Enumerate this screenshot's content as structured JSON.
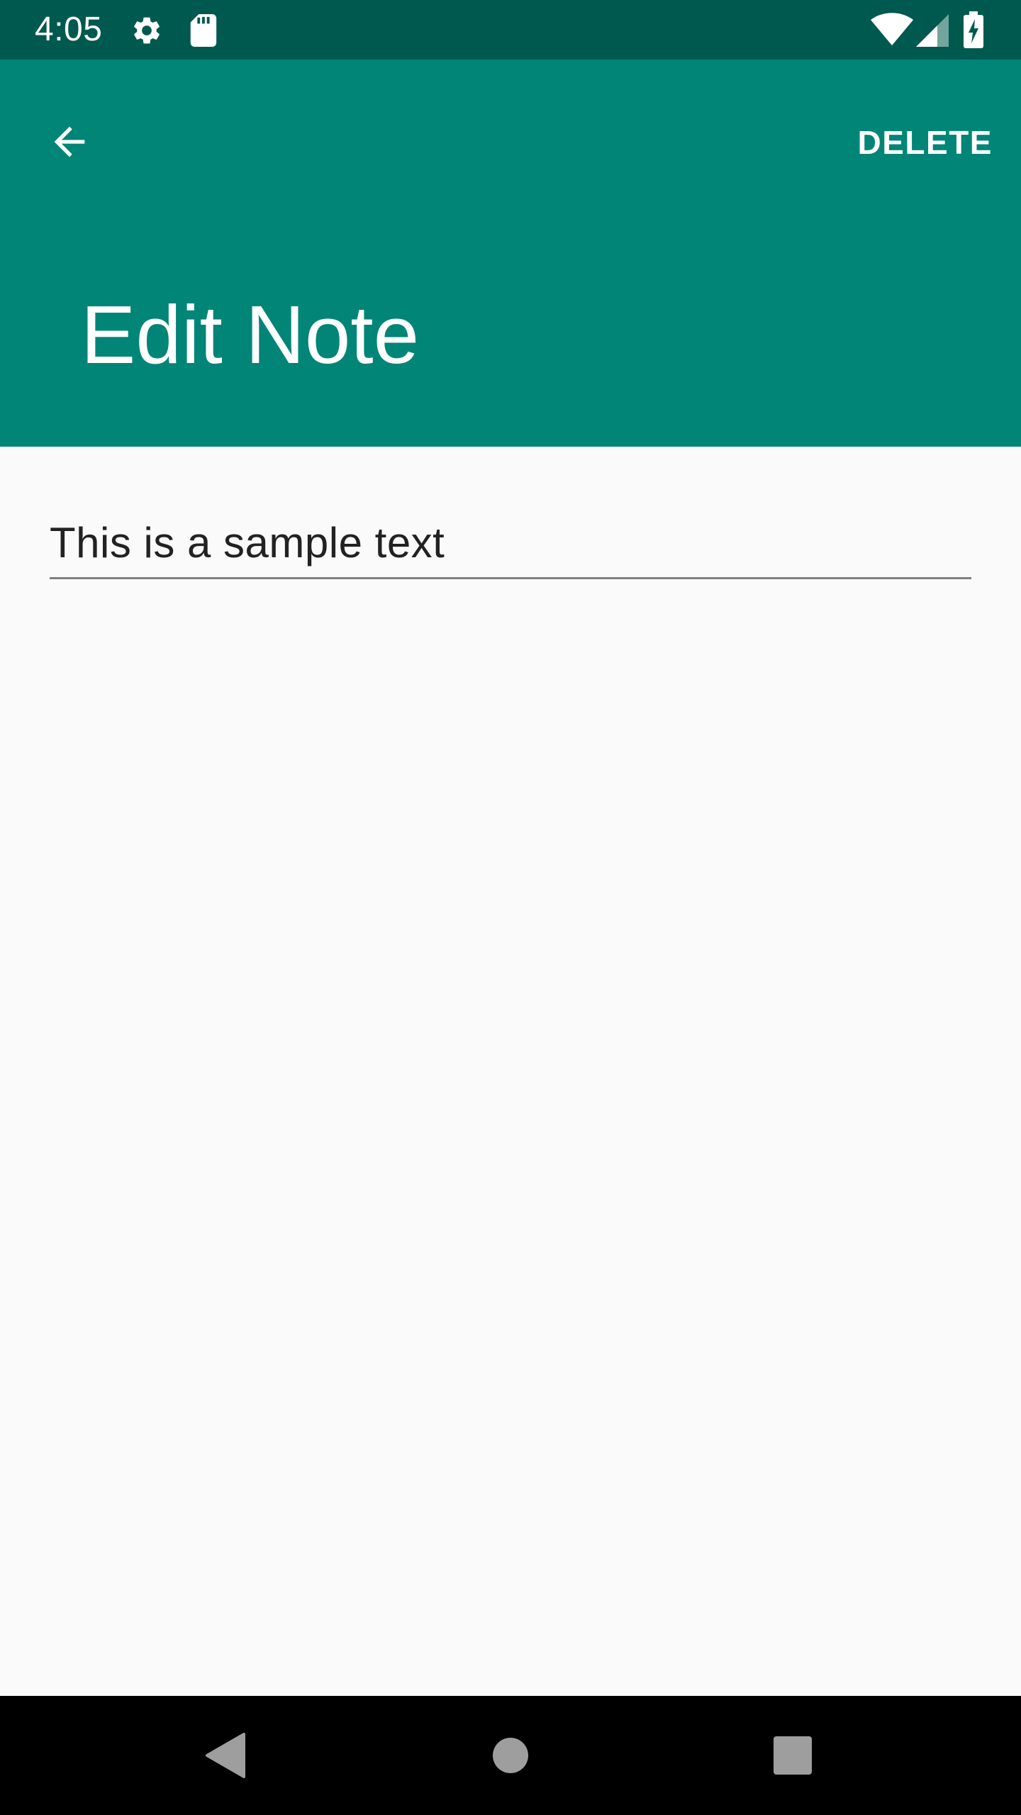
{
  "status_bar": {
    "time": "4:05",
    "icons": [
      "settings-icon",
      "sd-card-icon",
      "wifi-icon",
      "signal-icon",
      "battery-charging-icon"
    ]
  },
  "app_bar": {
    "back_icon": "arrow-back-icon",
    "delete_label": "DELETE",
    "title": "Edit Note"
  },
  "note": {
    "value": "This is a sample text"
  },
  "nav_bar": {
    "icons": [
      "nav-back-icon",
      "nav-home-icon",
      "nav-recents-icon"
    ]
  },
  "colors": {
    "status_bar": "#00594f",
    "app_bar": "#008577",
    "background": "#fafafa",
    "text": "#222222",
    "underline": "#808080",
    "nav_bar": "#000000",
    "nav_icon": "#9e9e9e"
  }
}
